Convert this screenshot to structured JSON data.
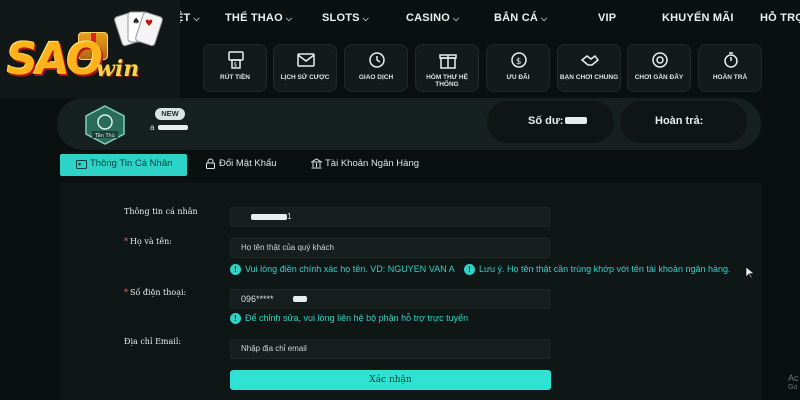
{
  "nav": {
    "items": [
      {
        "label": "ỆT",
        "chevron": true
      },
      {
        "label": "THỂ THAO",
        "chevron": true
      },
      {
        "label": "SLOTS",
        "chevron": true
      },
      {
        "label": "CASINO",
        "chevron": true
      },
      {
        "label": "BẮN CÁ",
        "chevron": true
      },
      {
        "label": "VIP",
        "chevron": false
      },
      {
        "label": "KHUYẾN MÃI",
        "chevron": false
      },
      {
        "label": "HỖ TRỢ",
        "chevron": false
      }
    ]
  },
  "logo": {
    "text": "SAO",
    "win": "win"
  },
  "toolbar": {
    "items": [
      {
        "label": "RÚT TIỀN",
        "icon": "atm-withdraw-icon"
      },
      {
        "label": "LỊCH SỬ CƯỢC",
        "icon": "bet-history-icon"
      },
      {
        "label": "GIAO DỊCH",
        "icon": "transaction-history-icon"
      },
      {
        "label": "HÒM THƯ HỆ THỐNG",
        "icon": "gift-mailbox-icon"
      },
      {
        "label": "ƯU ĐÃI",
        "icon": "dollar-coin-icon"
      },
      {
        "label": "BẠN CHƠI CHUNG",
        "icon": "handshake-icon"
      },
      {
        "label": "CHƠI GẦN ĐÂY",
        "icon": "chip-icon"
      },
      {
        "label": "HOÀN TRẢ",
        "icon": "stopwatch-icon"
      }
    ]
  },
  "profile": {
    "badge": "NEW",
    "rank": "Tân Thủ",
    "username": "a",
    "balance_label": "Số dư:",
    "refund_label": "Hoàn trả:"
  },
  "tabs": [
    {
      "label": "Thông Tin Cá Nhân",
      "active": true,
      "icon": "user-card-icon"
    },
    {
      "label": "Đổi Mật Khẩu",
      "active": false,
      "icon": "lock-icon"
    },
    {
      "label": "Tài Khoản Ngân Hàng",
      "active": false,
      "icon": "bank-icon"
    }
  ],
  "form": {
    "personal_info_label": "Thông tin cá nhân",
    "username_value": "1",
    "fullname_label": "Họ và tên:",
    "fullname_placeholder": "Họ tên thật của quý khách",
    "fullname_hint_1": "Vui lòng điền chính xác họ tên. VD: NGUYEN VAN A",
    "fullname_hint_2": "Lưu ý. Họ tên thật cần trùng khớp với tên tài khoản ngân hàng.",
    "phone_label": "Số điện thoại:",
    "phone_value": "096*****",
    "phone_hint": "Để chỉnh sửa, vui lòng liên hệ bộ phận hỗ trợ trực tuyến",
    "email_label": "Địa chỉ Email:",
    "email_placeholder": "Nhập địa chỉ email",
    "submit_label": "Xác nhận"
  },
  "corner": {
    "line1": "Ac",
    "line2": "Go"
  },
  "colors": {
    "accent": "#2cd3c6",
    "background": "#0a0f0f",
    "panel": "#0f1616",
    "logo_gold": "#ffb21a"
  }
}
